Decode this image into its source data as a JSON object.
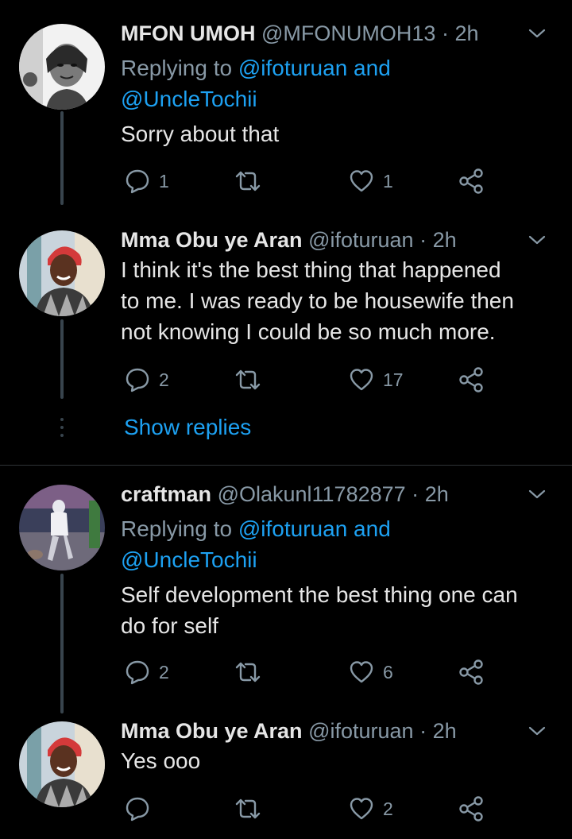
{
  "tweets": [
    {
      "name": "MFON UMOH",
      "handle": "@MFONUMOH13",
      "dot": "·",
      "time": "2h",
      "replying_prefix": "Replying to",
      "replying_user1": "@ifoturuan",
      "replying_and": "and",
      "replying_user2": "@UncleTochii",
      "lines": [
        "Sorry about that"
      ],
      "reply_count": "1",
      "retweet_count": "",
      "like_count": "1"
    },
    {
      "name": "Mma Obu ye Aran",
      "handle": "@ifoturuan",
      "dot": "·",
      "time": "2h",
      "lines": [
        "I think it's the best thing that happened",
        "to me. I was ready to be housewife then",
        "not knowing I could be so much more."
      ],
      "reply_count": "2",
      "retweet_count": "",
      "like_count": "17"
    },
    {
      "name": "craftman",
      "handle": "@Olakunl11782877",
      "dot": "·",
      "time": "2h",
      "replying_prefix": "Replying to",
      "replying_user1": "@ifoturuan",
      "replying_and": "and",
      "replying_user2": "@UncleTochii",
      "lines": [
        "Self development the best thing one can",
        "do for self"
      ],
      "reply_count": "2",
      "retweet_count": "",
      "like_count": "6"
    },
    {
      "name": "Mma Obu ye Aran",
      "handle": "@ifoturuan",
      "dot": "·",
      "time": "2h",
      "lines": [
        "Yes ooo"
      ],
      "reply_count": "",
      "retweet_count": "",
      "like_count": "2"
    }
  ],
  "show_replies": "Show replies",
  "icons": {
    "reply": "speech-bubble-icon",
    "retweet": "retweet-icon",
    "like": "heart-outline-icon",
    "share": "share-nodes-icon",
    "menu": "chevron-down-icon"
  },
  "colors": {
    "background": "#000000",
    "text": "#e6e6e6",
    "secondary": "#8899a6",
    "accent": "#1da1f2",
    "thread_line": "#38444d"
  }
}
